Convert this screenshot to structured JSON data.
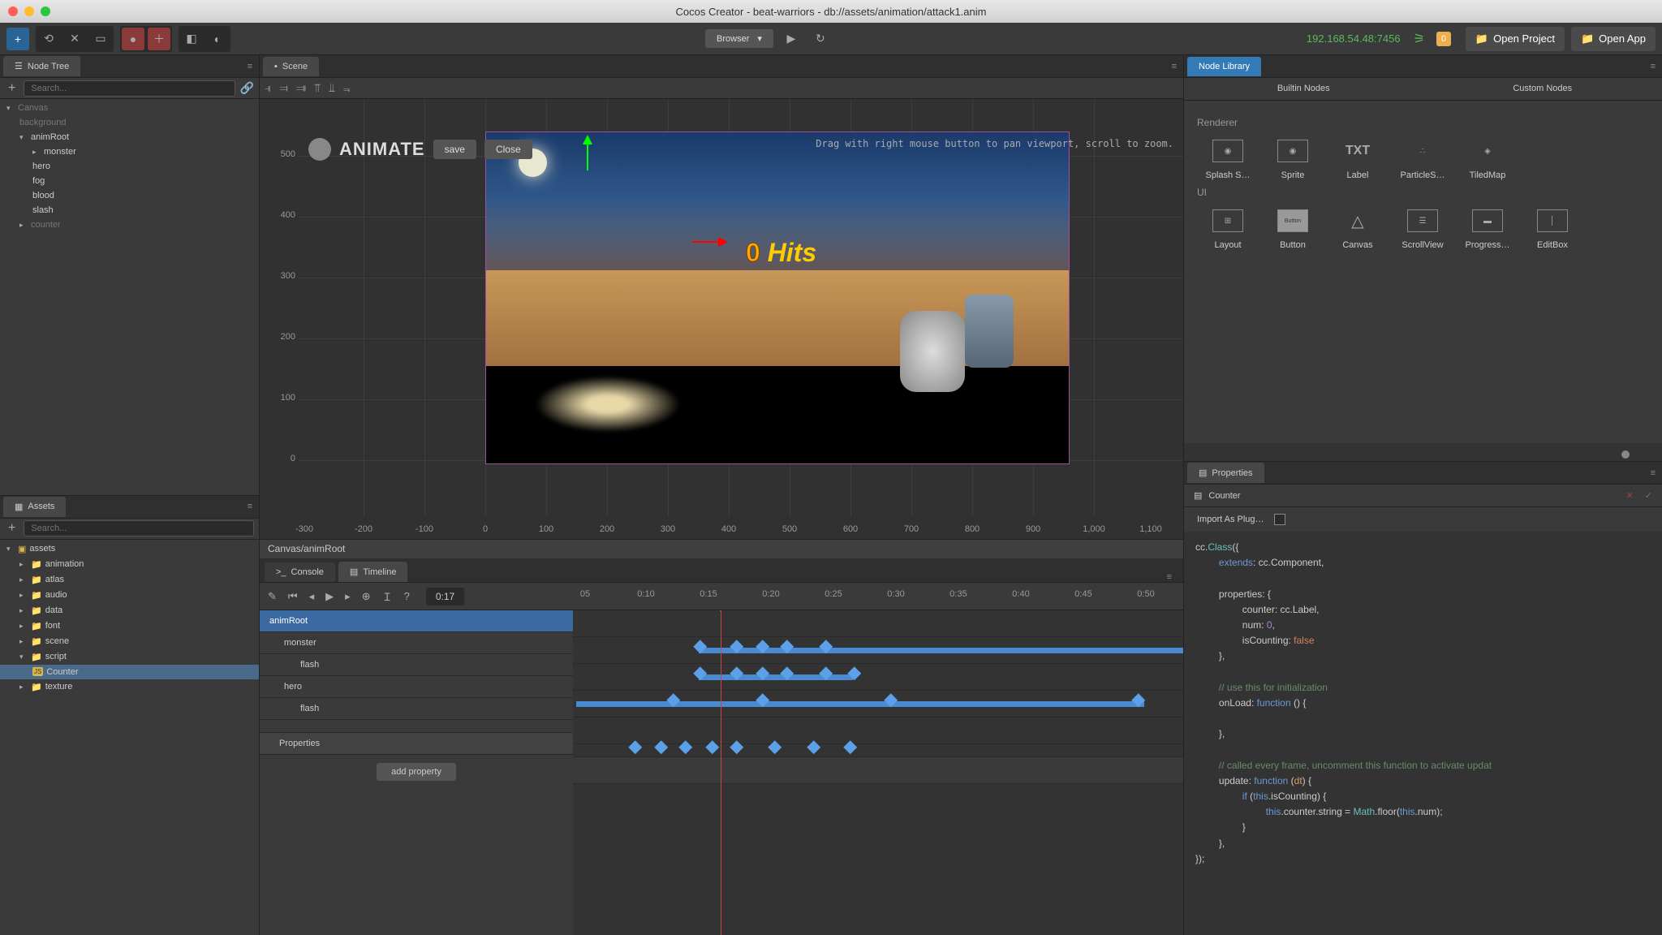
{
  "titlebar": {
    "title": "Cocos Creator - beat-warriors - db://assets/animation/attack1.anim"
  },
  "toolbar": {
    "runtime": "Browser",
    "ip": "192.168.54.48:7456",
    "notif_count": "0",
    "open_project": "Open Project",
    "open_app": "Open App"
  },
  "node_tree": {
    "title": "Node Tree",
    "search_placeholder": "Search...",
    "items": {
      "canvas": "Canvas",
      "background": "background",
      "animRoot": "animRoot",
      "monster": "monster",
      "hero": "hero",
      "fog": "fog",
      "blood": "blood",
      "slash": "slash",
      "counter": "counter"
    }
  },
  "assets": {
    "title": "Assets",
    "search_placeholder": "Search...",
    "root": "assets",
    "folders": [
      "animation",
      "atlas",
      "audio",
      "data",
      "font",
      "scene",
      "script",
      "texture"
    ],
    "script_file": "Counter"
  },
  "scene": {
    "title": "Scene",
    "animate_label": "ANIMATE",
    "save": "save",
    "close": "Close",
    "hint": "Drag with right mouse button to pan viewport, scroll to zoom.",
    "hits_num": "0",
    "hits_word": "Hits",
    "breadcrumb": "Canvas/animRoot",
    "ruler_y": [
      "500",
      "400",
      "300",
      "200",
      "100",
      "0"
    ],
    "ruler_x": [
      "-300",
      "-200",
      "-100",
      "0",
      "100",
      "200",
      "300",
      "400",
      "500",
      "600",
      "700",
      "800",
      "900",
      "1,000",
      "1,100"
    ]
  },
  "bottom": {
    "console_tab": "Console",
    "timeline_tab": "Timeline",
    "time": "0:17",
    "ruler": [
      "05",
      "0:10",
      "0:15",
      "0:20",
      "0:25",
      "0:30",
      "0:35",
      "0:40",
      "0:45",
      "0:50"
    ],
    "tracks": {
      "animRoot": "animRoot",
      "monster": "monster",
      "monster_flash": "flash",
      "hero": "hero",
      "hero_flash": "flash"
    },
    "properties_header": "Properties",
    "add_property": "add property"
  },
  "node_library": {
    "title": "Node Library",
    "tab_builtin": "Builtin Nodes",
    "tab_custom": "Custom Nodes",
    "section_renderer": "Renderer",
    "section_ui": "UI",
    "items": {
      "splash": "Splash S…",
      "sprite": "Sprite",
      "label": "Label",
      "particle": "ParticleS…",
      "tiledmap": "TiledMap",
      "layout": "Layout",
      "button": "Button",
      "canvas": "Canvas",
      "scrollview": "ScrollView",
      "progress": "Progress…",
      "editbox": "EditBox"
    }
  },
  "properties": {
    "title": "Properties",
    "component": "Counter",
    "import_plugin": "Import As Plug…"
  },
  "code": {
    "l1a": "cc.",
    "l1b": "Class",
    "l1c": "({",
    "l2a": "extends",
    "l2b": ": cc.Component,",
    "l3": "properties: {",
    "l4": "counter: cc.Label,",
    "l5a": "num: ",
    "l5b": "0",
    "l5c": ",",
    "l6a": "isCounting: ",
    "l6b": "false",
    "l7": "},",
    "l8": "// use this for initialization",
    "l9a": "onLoad: ",
    "l9b": "function",
    "l9c": " () {",
    "l10": "},",
    "l11": "// called every frame, uncomment this function to activate updat",
    "l12a": "update: ",
    "l12b": "function",
    "l12c": " (",
    "l12d": "dt",
    "l12e": ") {",
    "l13a": "if",
    "l13b": " (",
    "l13c": "this",
    "l13d": ".isCounting) {",
    "l14a": "this",
    "l14b": ".counter.string = ",
    "l14c": "Math",
    "l14d": ".floor(",
    "l14e": "this",
    "l14f": ".num);",
    "l15": "}",
    "l16": "},",
    "l17": "});"
  }
}
